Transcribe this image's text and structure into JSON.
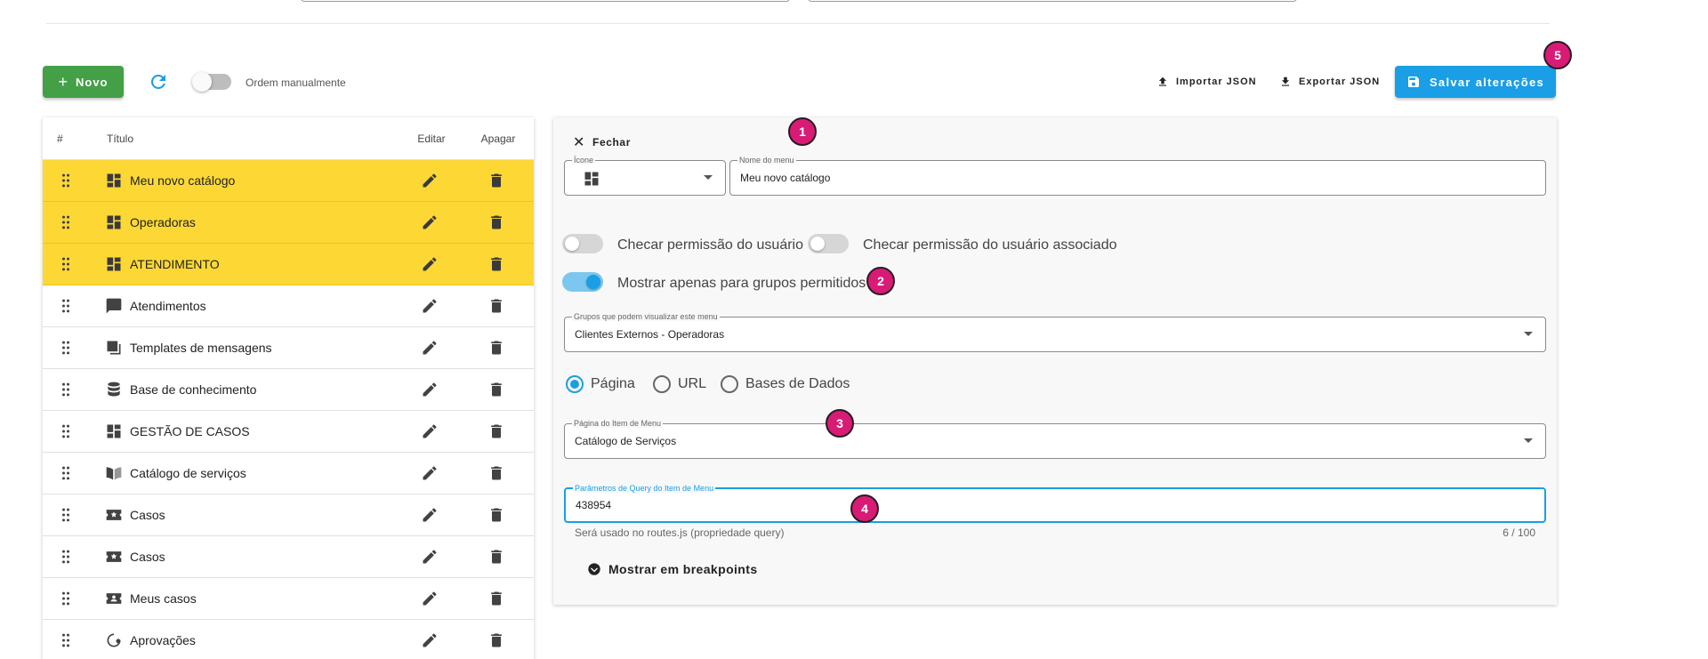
{
  "toolbar": {
    "new_label": "Novo",
    "manual_order_label": "Ordem manualmente",
    "import_label": "Importar JSON",
    "export_label": "Exportar JSON",
    "save_label": "Salvar alterações"
  },
  "table": {
    "headers": {
      "num": "#",
      "title": "Título",
      "edit": "Editar",
      "delete": "Apagar"
    },
    "rows": [
      {
        "title": "Meu novo catálogo",
        "icon": "dashboard-icon",
        "highlighted": true
      },
      {
        "title": "Operadoras",
        "icon": "dashboard-icon",
        "highlighted": true
      },
      {
        "title": "ATENDIMENTO",
        "icon": "dashboard-icon",
        "highlighted": true
      },
      {
        "title": "Atendimentos",
        "icon": "chat-icon",
        "highlighted": false
      },
      {
        "title": "Templates de mensagens",
        "icon": "templates-icon",
        "highlighted": false
      },
      {
        "title": "Base de conhecimento",
        "icon": "database-icon",
        "highlighted": false
      },
      {
        "title": "GESTÃO DE CASOS",
        "icon": "dashboard-icon",
        "highlighted": false
      },
      {
        "title": "Catálogo de serviços",
        "icon": "book-icon",
        "highlighted": false
      },
      {
        "title": "Casos",
        "icon": "ticket-star-icon",
        "highlighted": false
      },
      {
        "title": "Casos",
        "icon": "ticket-star-icon",
        "highlighted": false
      },
      {
        "title": "Meus casos",
        "icon": "ticket-person-icon",
        "highlighted": false
      },
      {
        "title": "Aprovações",
        "icon": "approval-icon",
        "highlighted": false
      }
    ]
  },
  "editor": {
    "close_label": "Fechar",
    "icon_label": "Ícone",
    "menu_name_label": "Nome do menu",
    "menu_name_value": "Meu novo catálogo",
    "check_user_perm": "Checar permissão do usuário",
    "check_assoc_user_perm": "Checar permissão do usuário associado",
    "show_allowed_groups": "Mostrar apenas para grupos permitidos",
    "groups_label": "Grupos que podem visualizar este menu",
    "groups_value": "Clientes Externos - Operadoras",
    "radio_page": "Página",
    "radio_url": "URL",
    "radio_db": "Bases de Dados",
    "page_label": "Página do Item de Menu",
    "page_value": "Catálogo de Serviços",
    "query_label": "Parâmetros de Query do Item de Menu",
    "query_value": "438954",
    "query_hint": "Será usado no routes.js (propriedade query)",
    "query_counter": "6 / 100",
    "breakpoints_label": "Mostrar em breakpoints"
  },
  "badges": {
    "b1": "1",
    "b2": "2",
    "b3": "3",
    "b4": "4",
    "b5": "5"
  },
  "colors": {
    "accent": "#1a9ee5",
    "success": "#43a047",
    "highlight": "#fdd835",
    "badge": "#d81b75"
  }
}
